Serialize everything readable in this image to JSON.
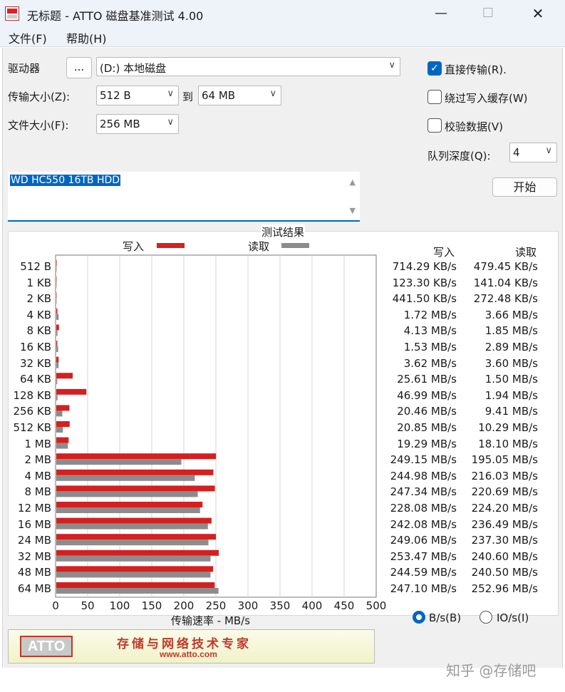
{
  "window": {
    "title": "无标题 - ATTO 磁盘基准测试 4.00",
    "minimize_glyph": "—",
    "maximize_glyph": "☐",
    "close_glyph": "✕"
  },
  "menu": {
    "file": "文件(F)",
    "help": "帮助(H)"
  },
  "settings": {
    "drive_label": "驱动器",
    "browse_label": "...",
    "drive_value": "(D:) 本地磁盘",
    "transfer_label": "传输大小(Z):",
    "transfer_from": "512 B",
    "to_label": "到",
    "transfer_to": "64 MB",
    "filesize_label": "文件大小(F):",
    "filesize_value": "256 MB",
    "direct_io_label": "直接传输(R).",
    "direct_io_checked": true,
    "bypass_write_cache_label": "绕过写入缓存(W)",
    "bypass_write_cache_checked": false,
    "verify_data_label": "校验数据(V)",
    "verify_data_checked": false,
    "queue_depth_label": "队列深度(Q):",
    "queue_depth_value": "4",
    "start_label": "开始",
    "description": "WD HC550 16TB HDD"
  },
  "results": {
    "group_title": "测试结果",
    "write_legend": "写入",
    "read_legend": "读取",
    "write_header": "写入",
    "read_header": "读取",
    "rows": [
      {
        "size": "512 B",
        "write": "714.29 KB/s",
        "read": "479.45 KB/s"
      },
      {
        "size": "1 KB",
        "write": "123.30 KB/s",
        "read": "141.04 KB/s"
      },
      {
        "size": "2 KB",
        "write": "441.50 KB/s",
        "read": "272.48 KB/s"
      },
      {
        "size": "4 KB",
        "write": "1.72 MB/s",
        "read": "3.66 MB/s"
      },
      {
        "size": "8 KB",
        "write": "4.13 MB/s",
        "read": "1.85 MB/s"
      },
      {
        "size": "16 KB",
        "write": "1.53 MB/s",
        "read": "2.89 MB/s"
      },
      {
        "size": "32 KB",
        "write": "3.62 MB/s",
        "read": "3.60 MB/s"
      },
      {
        "size": "64 KB",
        "write": "25.61 MB/s",
        "read": "1.50 MB/s"
      },
      {
        "size": "128 KB",
        "write": "46.99 MB/s",
        "read": "1.94 MB/s"
      },
      {
        "size": "256 KB",
        "write": "20.46 MB/s",
        "read": "9.41 MB/s"
      },
      {
        "size": "512 KB",
        "write": "20.85 MB/s",
        "read": "10.29 MB/s"
      },
      {
        "size": "1 MB",
        "write": "19.29 MB/s",
        "read": "18.10 MB/s"
      },
      {
        "size": "2 MB",
        "write": "249.15 MB/s",
        "read": "195.05 MB/s"
      },
      {
        "size": "4 MB",
        "write": "244.98 MB/s",
        "read": "216.03 MB/s"
      },
      {
        "size": "8 MB",
        "write": "247.34 MB/s",
        "read": "220.69 MB/s"
      },
      {
        "size": "12 MB",
        "write": "228.08 MB/s",
        "read": "224.20 MB/s"
      },
      {
        "size": "16 MB",
        "write": "242.08 MB/s",
        "read": "236.49 MB/s"
      },
      {
        "size": "24 MB",
        "write": "249.06 MB/s",
        "read": "237.30 MB/s"
      },
      {
        "size": "32 MB",
        "write": "253.47 MB/s",
        "read": "240.60 MB/s"
      },
      {
        "size": "48 MB",
        "write": "244.59 MB/s",
        "read": "240.50 MB/s"
      },
      {
        "size": "64 MB",
        "write": "247.10 MB/s",
        "read": "252.96 MB/s"
      }
    ],
    "xlabel": "传输速率 - MB/s",
    "unit_bytes_label": "B/s(B)",
    "unit_io_label": "IO/s(I)",
    "unit_selected": "B/s"
  },
  "chart_data": {
    "type": "bar",
    "orientation": "horizontal",
    "categories": [
      "512 B",
      "1 KB",
      "2 KB",
      "4 KB",
      "8 KB",
      "16 KB",
      "32 KB",
      "64 KB",
      "128 KB",
      "256 KB",
      "512 KB",
      "1 MB",
      "2 MB",
      "4 MB",
      "8 MB",
      "12 MB",
      "16 MB",
      "24 MB",
      "32 MB",
      "48 MB",
      "64 MB"
    ],
    "series": [
      {
        "name": "写入",
        "color": "#d42020",
        "values": [
          0.714,
          0.123,
          0.442,
          1.72,
          4.13,
          1.53,
          3.62,
          25.61,
          46.99,
          20.46,
          20.85,
          19.29,
          249.15,
          244.98,
          247.34,
          228.08,
          242.08,
          249.06,
          253.47,
          244.59,
          247.1
        ]
      },
      {
        "name": "读取",
        "color": "#8c8c8c",
        "values": [
          0.479,
          0.141,
          0.272,
          3.66,
          1.85,
          2.89,
          3.6,
          1.5,
          1.94,
          9.41,
          10.29,
          18.1,
          195.05,
          216.03,
          220.69,
          224.2,
          236.49,
          237.3,
          240.6,
          240.5,
          252.96
        ]
      }
    ],
    "xlabel": "传输速率 - MB/s",
    "xlim": [
      0,
      500
    ],
    "xticks": [
      0,
      50,
      100,
      150,
      200,
      250,
      300,
      350,
      400,
      450,
      500
    ],
    "grid": true
  },
  "banner": {
    "logo": "ATTO",
    "slogan": "存储与网络技术专家",
    "url": "www.atto.com"
  },
  "watermark": "知乎 @存储吧"
}
